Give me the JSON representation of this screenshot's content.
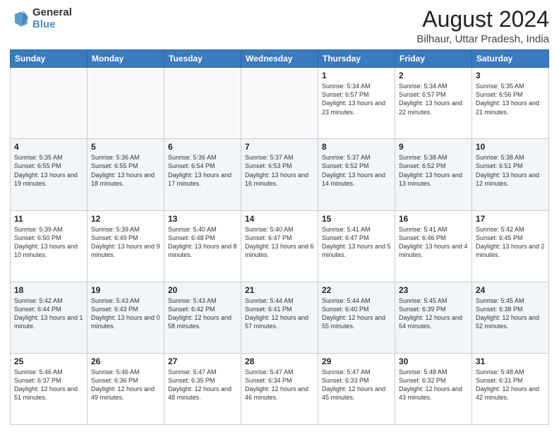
{
  "logo": {
    "line1": "General",
    "line2": "Blue"
  },
  "title": "August 2024",
  "subtitle": "Bilhaur, Uttar Pradesh, India",
  "headers": [
    "Sunday",
    "Monday",
    "Tuesday",
    "Wednesday",
    "Thursday",
    "Friday",
    "Saturday"
  ],
  "weeks": [
    [
      {
        "day": "",
        "info": ""
      },
      {
        "day": "",
        "info": ""
      },
      {
        "day": "",
        "info": ""
      },
      {
        "day": "",
        "info": ""
      },
      {
        "day": "1",
        "info": "Sunrise: 5:34 AM\nSunset: 6:57 PM\nDaylight: 13 hours\nand 23 minutes."
      },
      {
        "day": "2",
        "info": "Sunrise: 5:34 AM\nSunset: 6:57 PM\nDaylight: 13 hours\nand 22 minutes."
      },
      {
        "day": "3",
        "info": "Sunrise: 5:35 AM\nSunset: 6:56 PM\nDaylight: 13 hours\nand 21 minutes."
      }
    ],
    [
      {
        "day": "4",
        "info": "Sunrise: 5:35 AM\nSunset: 6:55 PM\nDaylight: 13 hours\nand 19 minutes."
      },
      {
        "day": "5",
        "info": "Sunrise: 5:36 AM\nSunset: 6:55 PM\nDaylight: 13 hours\nand 18 minutes."
      },
      {
        "day": "6",
        "info": "Sunrise: 5:36 AM\nSunset: 6:54 PM\nDaylight: 13 hours\nand 17 minutes."
      },
      {
        "day": "7",
        "info": "Sunrise: 5:37 AM\nSunset: 6:53 PM\nDaylight: 13 hours\nand 16 minutes."
      },
      {
        "day": "8",
        "info": "Sunrise: 5:37 AM\nSunset: 6:52 PM\nDaylight: 13 hours\nand 14 minutes."
      },
      {
        "day": "9",
        "info": "Sunrise: 5:38 AM\nSunset: 6:52 PM\nDaylight: 13 hours\nand 13 minutes."
      },
      {
        "day": "10",
        "info": "Sunrise: 5:38 AM\nSunset: 6:51 PM\nDaylight: 13 hours\nand 12 minutes."
      }
    ],
    [
      {
        "day": "11",
        "info": "Sunrise: 5:39 AM\nSunset: 6:50 PM\nDaylight: 13 hours\nand 10 minutes."
      },
      {
        "day": "12",
        "info": "Sunrise: 5:39 AM\nSunset: 6:49 PM\nDaylight: 13 hours\nand 9 minutes."
      },
      {
        "day": "13",
        "info": "Sunrise: 5:40 AM\nSunset: 6:48 PM\nDaylight: 13 hours\nand 8 minutes."
      },
      {
        "day": "14",
        "info": "Sunrise: 5:40 AM\nSunset: 6:47 PM\nDaylight: 13 hours\nand 6 minutes."
      },
      {
        "day": "15",
        "info": "Sunrise: 5:41 AM\nSunset: 6:47 PM\nDaylight: 13 hours\nand 5 minutes."
      },
      {
        "day": "16",
        "info": "Sunrise: 5:41 AM\nSunset: 6:46 PM\nDaylight: 13 hours\nand 4 minutes."
      },
      {
        "day": "17",
        "info": "Sunrise: 5:42 AM\nSunset: 6:45 PM\nDaylight: 13 hours\nand 2 minutes."
      }
    ],
    [
      {
        "day": "18",
        "info": "Sunrise: 5:42 AM\nSunset: 6:44 PM\nDaylight: 13 hours\nand 1 minute."
      },
      {
        "day": "19",
        "info": "Sunrise: 5:43 AM\nSunset: 6:43 PM\nDaylight: 13 hours\nand 0 minutes."
      },
      {
        "day": "20",
        "info": "Sunrise: 5:43 AM\nSunset: 6:42 PM\nDaylight: 12 hours\nand 58 minutes."
      },
      {
        "day": "21",
        "info": "Sunrise: 5:44 AM\nSunset: 6:41 PM\nDaylight: 12 hours\nand 57 minutes."
      },
      {
        "day": "22",
        "info": "Sunrise: 5:44 AM\nSunset: 6:40 PM\nDaylight: 12 hours\nand 55 minutes."
      },
      {
        "day": "23",
        "info": "Sunrise: 5:45 AM\nSunset: 6:39 PM\nDaylight: 12 hours\nand 54 minutes."
      },
      {
        "day": "24",
        "info": "Sunrise: 5:45 AM\nSunset: 6:38 PM\nDaylight: 12 hours\nand 52 minutes."
      }
    ],
    [
      {
        "day": "25",
        "info": "Sunrise: 5:46 AM\nSunset: 6:37 PM\nDaylight: 12 hours\nand 51 minutes."
      },
      {
        "day": "26",
        "info": "Sunrise: 5:46 AM\nSunset: 6:36 PM\nDaylight: 12 hours\nand 49 minutes."
      },
      {
        "day": "27",
        "info": "Sunrise: 5:47 AM\nSunset: 6:35 PM\nDaylight: 12 hours\nand 48 minutes."
      },
      {
        "day": "28",
        "info": "Sunrise: 5:47 AM\nSunset: 6:34 PM\nDaylight: 12 hours\nand 46 minutes."
      },
      {
        "day": "29",
        "info": "Sunrise: 5:47 AM\nSunset: 6:33 PM\nDaylight: 12 hours\nand 45 minutes."
      },
      {
        "day": "30",
        "info": "Sunrise: 5:48 AM\nSunset: 6:32 PM\nDaylight: 12 hours\nand 43 minutes."
      },
      {
        "day": "31",
        "info": "Sunrise: 5:48 AM\nSunset: 6:31 PM\nDaylight: 12 hours\nand 42 minutes."
      }
    ]
  ]
}
